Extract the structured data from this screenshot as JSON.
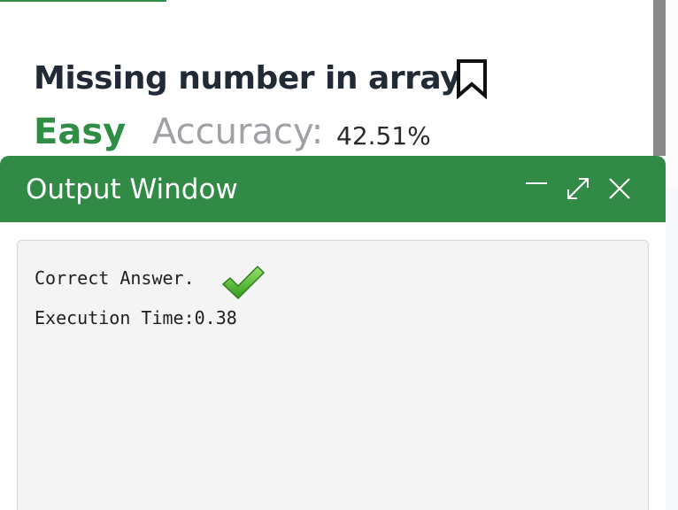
{
  "problem": {
    "title": "Missing number in array",
    "difficulty": "Easy",
    "accuracy_label": "Accuracy:",
    "accuracy_value": "42.51%"
  },
  "output_window": {
    "title": "Output Window",
    "result": "Correct Answer.",
    "execution_time": "Execution Time:0.38",
    "icons": {
      "minimize": "minimize-icon",
      "maximize": "maximize-icon",
      "close": "close-icon",
      "success": "checkmark-icon"
    }
  },
  "icons": {
    "bookmark": "bookmark-icon"
  },
  "colors": {
    "brand_green": "#318b46",
    "difficulty_green": "#2f8d46",
    "title_text": "#222a36",
    "muted_text": "#a0a0a6"
  }
}
